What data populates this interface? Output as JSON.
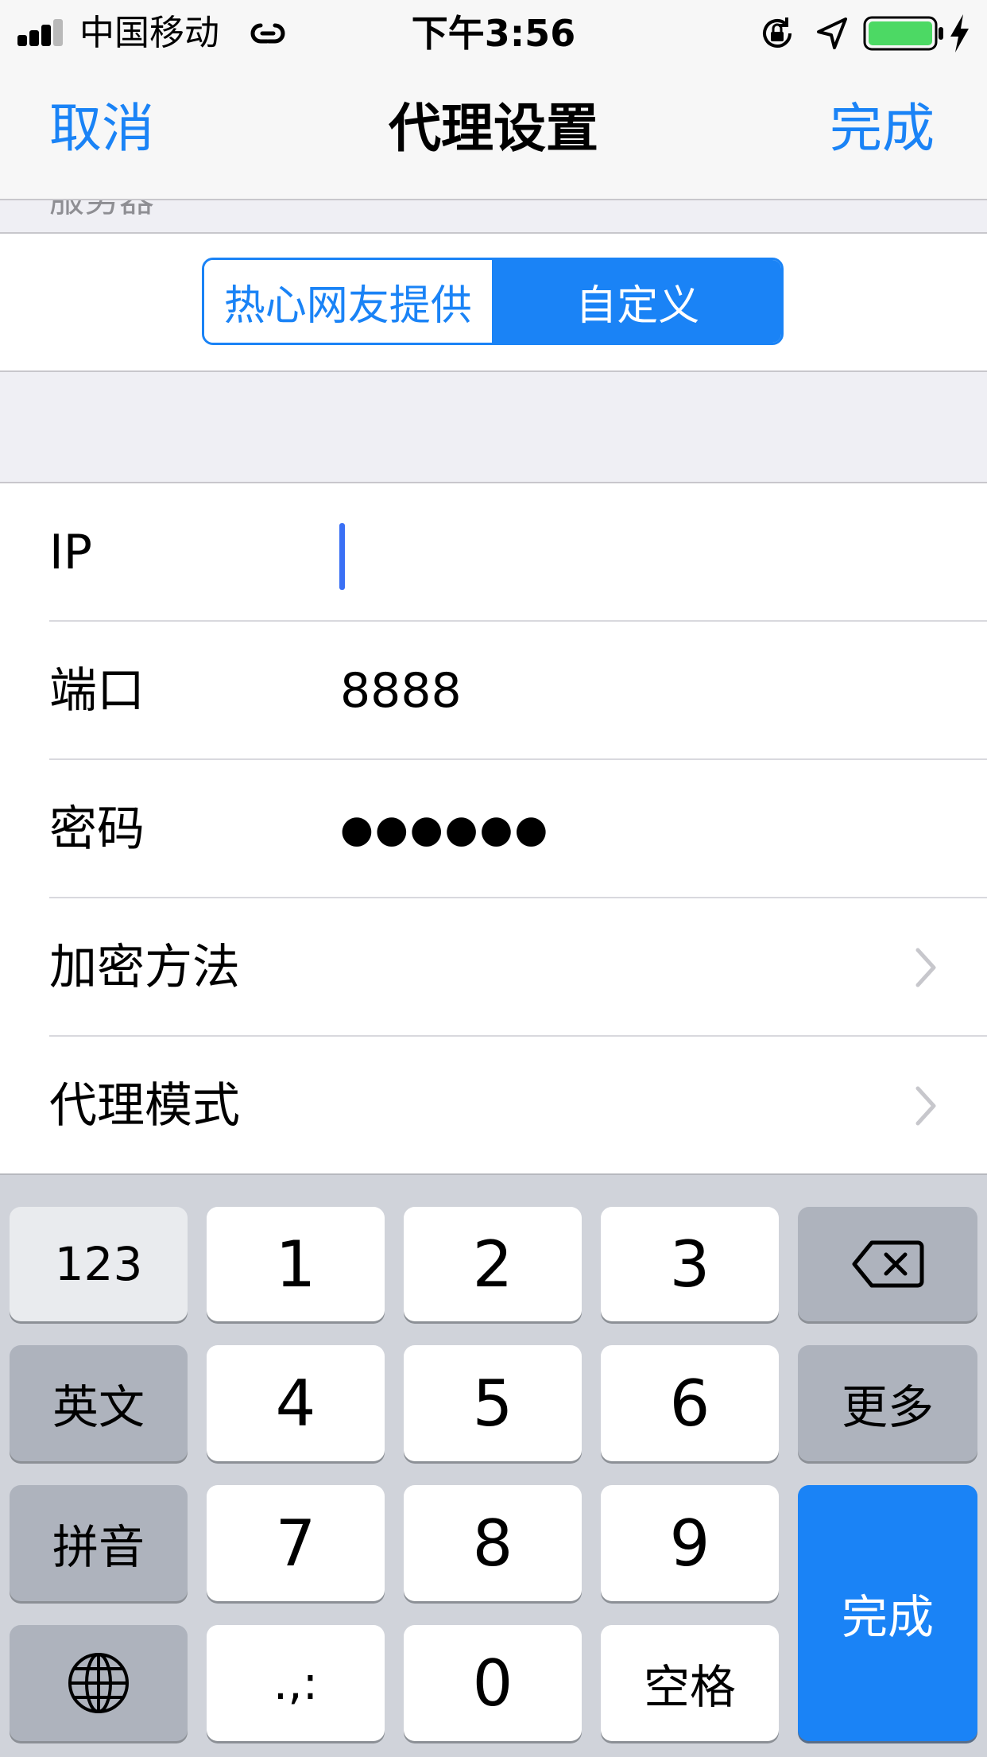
{
  "status_bar": {
    "carrier": "中国移动",
    "time": "下午3:56",
    "signal_bars_filled": 3,
    "signal_bars_total": 5,
    "battery_level": 1.0,
    "icons": [
      "signal-icon",
      "hotspot-icon",
      "rotation-lock-icon",
      "location-arrow-icon",
      "battery-icon",
      "charging-bolt-icon"
    ]
  },
  "nav": {
    "cancel": "取消",
    "title": "代理设置",
    "done": "完成"
  },
  "section_header_peek": "服务器",
  "segment": {
    "options": [
      "热心网友提供",
      "自定义"
    ],
    "selected": "自定义"
  },
  "form": {
    "ip": {
      "label": "IP",
      "value": ""
    },
    "port": {
      "label": "端口",
      "value": "8888"
    },
    "password": {
      "label": "密码",
      "value": "●●●●●●"
    },
    "encryption": {
      "label": "加密方法"
    },
    "proxy_mode": {
      "label": "代理模式"
    }
  },
  "keyboard": {
    "numbers_key": "123",
    "english_key": "英文",
    "pinyin_key": "拼音",
    "more_key": "更多",
    "space_key": "空格",
    "done_key": "完成",
    "punct_key": ".,:",
    "digits": [
      "1",
      "2",
      "3",
      "4",
      "5",
      "6",
      "7",
      "8",
      "9",
      "0"
    ],
    "accent_color": "#1a83f6"
  }
}
